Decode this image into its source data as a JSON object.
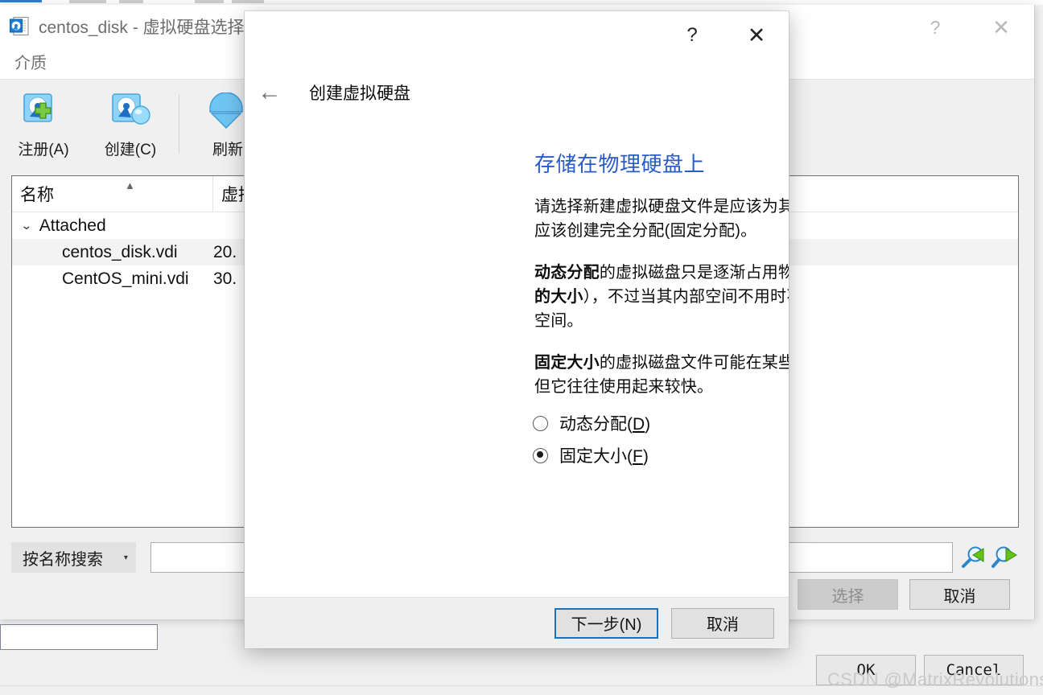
{
  "selector_window": {
    "title": "centos_disk - 虚拟硬盘选择",
    "title_icon": "vdi-file-icon",
    "subtitle": "介质",
    "help_label": "?",
    "close_label": "✕",
    "toolbar": [
      {
        "label": "注册(A)",
        "icon": "disk-add-icon"
      },
      {
        "label": "创建(C)",
        "icon": "disk-create-icon"
      },
      {
        "label": "刷新",
        "icon": "refresh-icon"
      }
    ],
    "list": {
      "columns": [
        {
          "label": "名称",
          "sort": "▲"
        },
        {
          "label": "虚拟大小"
        }
      ],
      "group": {
        "label": "Attached",
        "chevron": "⌄"
      },
      "rows": [
        {
          "name": "centos_disk.vdi",
          "size": "20.",
          "selected": true
        },
        {
          "name": "CentOS_mini.vdi",
          "size": "30.",
          "selected": false
        }
      ]
    },
    "search": {
      "mode_label": "按名称搜索",
      "caret": "▾",
      "value": "",
      "placeholder": "",
      "prev_icon": "search-prev-icon",
      "next_icon": "search-next-icon"
    },
    "footer": {
      "select_label": "选择",
      "select_disabled": true,
      "cancel_label": "取消"
    }
  },
  "outer_window": {
    "ok_label": "OK",
    "cancel_label": "Cancel",
    "textbox_value": ""
  },
  "wizard": {
    "help_label": "?",
    "close_label": "✕",
    "back_icon": "back-arrow-icon",
    "head_title": "创建虚拟硬盘",
    "heading": "存储在物理硬盘上",
    "paragraphs": [
      {
        "runs": [
          {
            "text": "请选择新建虚拟硬盘文件是应该为其使用而分配(动态分配)，还是应该创建完全分配(固定分配)。",
            "bold": false
          }
        ]
      },
      {
        "runs": [
          {
            "text": "动态分配",
            "bold": true
          },
          {
            "text": "的虚拟磁盘只是逐渐占用物理硬盘的空间（直至达到 ",
            "bold": false
          },
          {
            "text": "分配的大小",
            "bold": true
          },
          {
            "text": "），不过当其内部空间不用时不会自动缩减占用的物理硬盘空间。",
            "bold": false
          }
        ]
      },
      {
        "runs": [
          {
            "text": "固定大小",
            "bold": true
          },
          {
            "text": "的虚拟磁盘文件可能在某些系统中要花很长时间来创建，但它往往使用起来较快。",
            "bold": false
          }
        ]
      }
    ],
    "options": [
      {
        "label": "动态分配(",
        "accel": "D",
        "label_end": ")",
        "selected": false
      },
      {
        "label": "固定大小(",
        "accel": "F",
        "label_end": ")",
        "selected": true
      }
    ],
    "next_label": "下一步(N)",
    "cancel_label": "取消"
  },
  "watermark": "CSDN @MatrixRevolutions",
  "colors": {
    "accent_blue": "#2a5cc8",
    "focus_blue": "#1573c6",
    "window_bg": "#f0f0f0",
    "dialog_bg": "#ffffff"
  }
}
